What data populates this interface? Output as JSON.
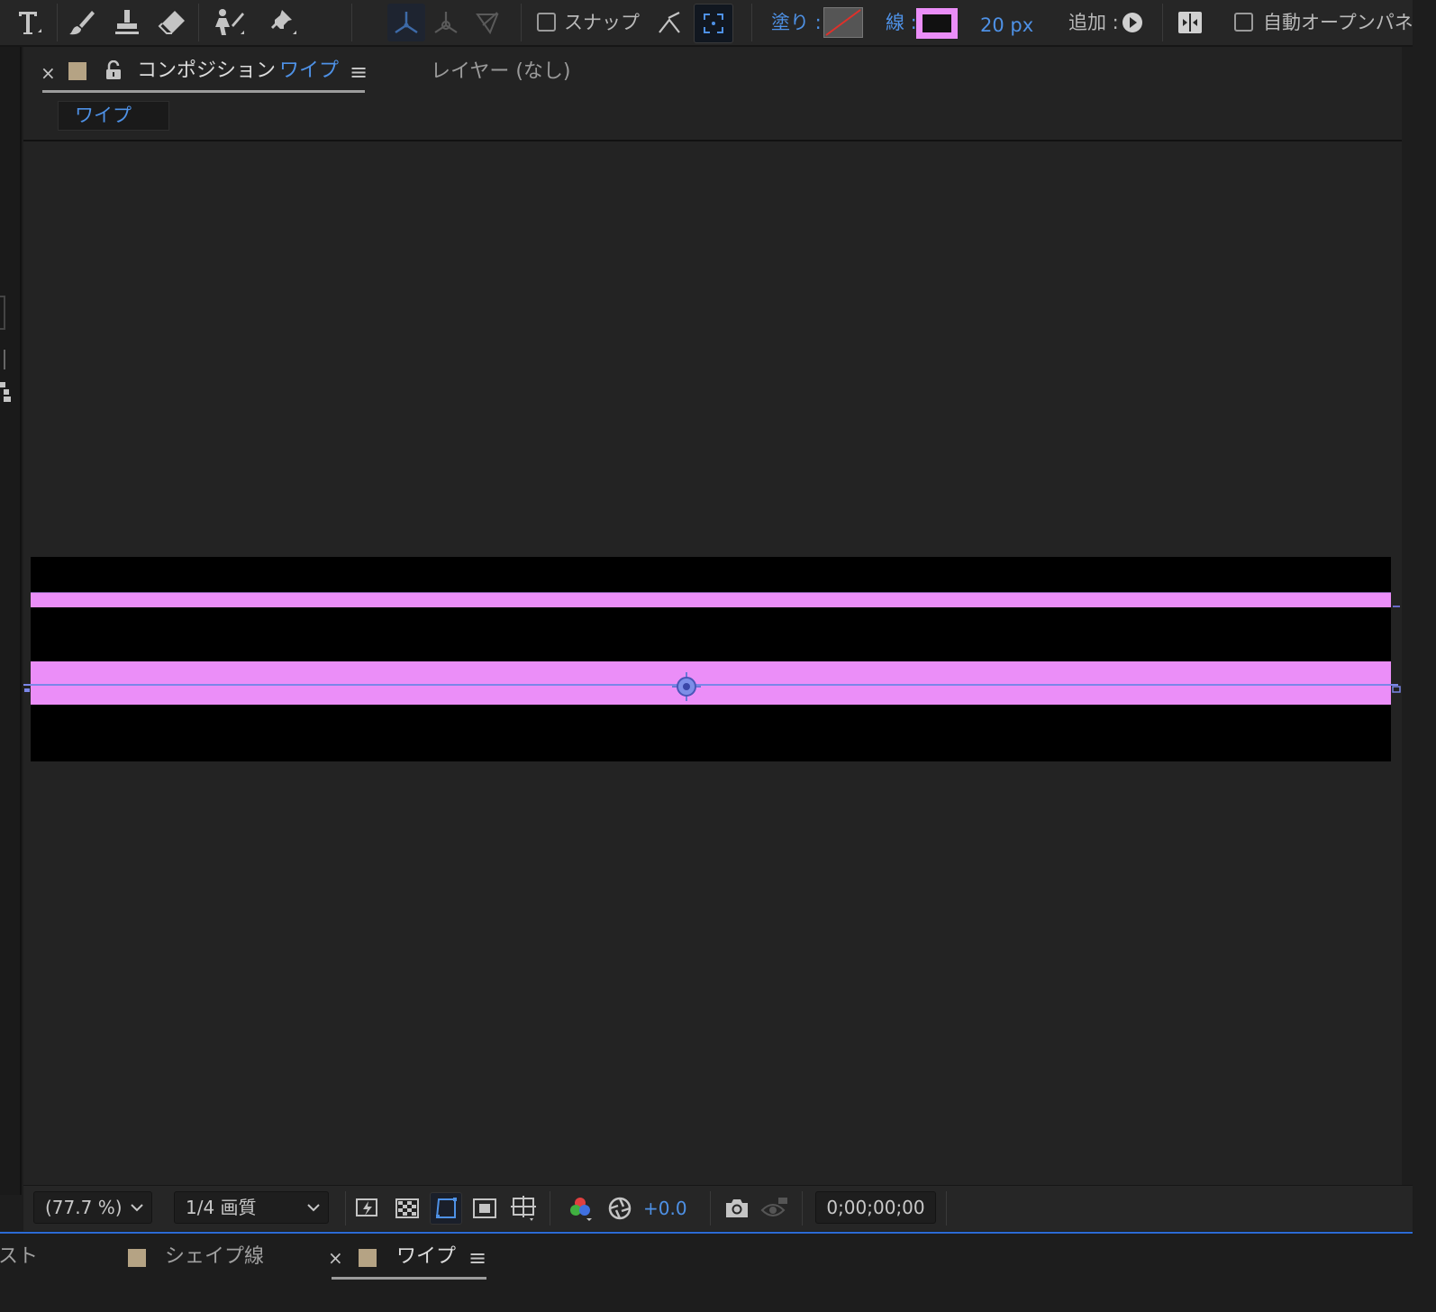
{
  "toolbar": {
    "snap_label": "スナップ",
    "fill_label": "塗り :",
    "stroke_label": "線 :",
    "stroke_width": "20 px",
    "add_label": "追加 :",
    "auto_open_label": "自動オープンパネ",
    "stroke_color": "#eb8ef8",
    "accent_color": "#4e91e6"
  },
  "panel": {
    "close_symbol": "×",
    "comp_prefix": "コンポジション",
    "comp_name": "ワイプ",
    "menu_symbol": "≡",
    "layer_tab": "レイヤー (なし)",
    "breadcrumb": "ワイプ"
  },
  "viewer_footer": {
    "zoom": "(77.7 %)",
    "resolution": "1/4 画質",
    "exposure": "+0.0",
    "timecode": "0;00;00;00"
  },
  "timeline_tabs": {
    "partial_tab": "スト",
    "tab_shape": "シェイプ線",
    "close_symbol": "×",
    "tab_wipe": "ワイプ",
    "menu_symbol": "≡"
  }
}
